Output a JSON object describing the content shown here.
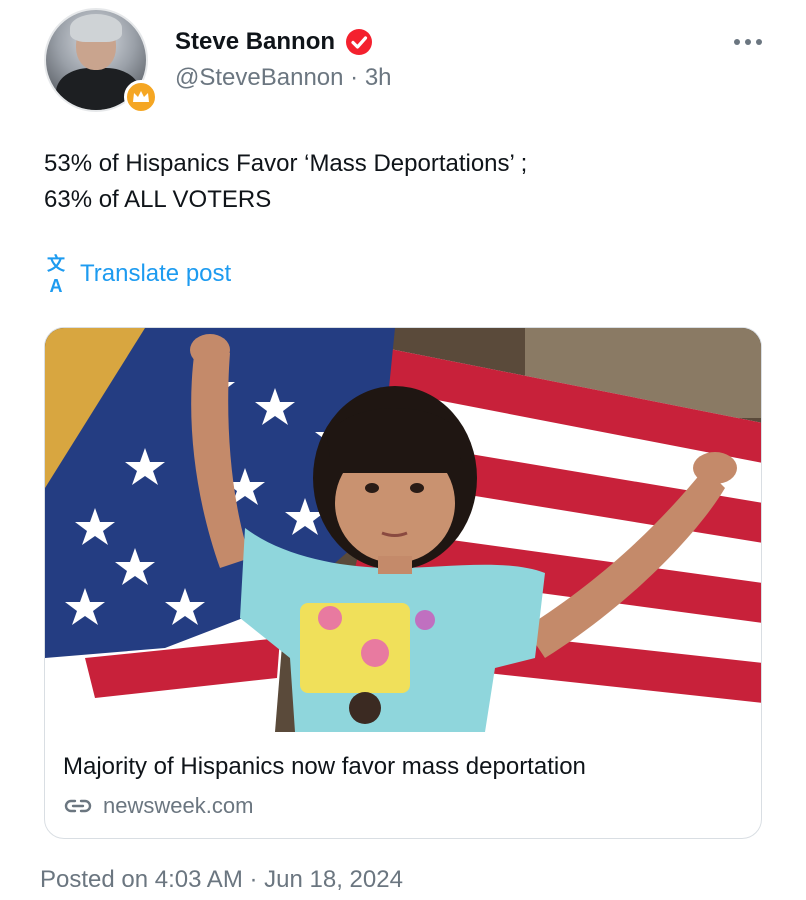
{
  "author": {
    "display_name": "Steve Bannon",
    "handle": "@SteveBannon",
    "separator": "·",
    "age": "3h",
    "verified_color": "#f4212e",
    "badge_color": "#f5a623",
    "avatar_icon": "profile-photo",
    "badge_icon": "crown-badge-icon",
    "verified_icon": "verified-check-icon"
  },
  "menu": {
    "icon": "more-horizontal-icon"
  },
  "post": {
    "lines": [
      "53% of Hispanics Favor ‘Mass Deportations’ ;",
      "63% of ALL VOTERS"
    ]
  },
  "translate": {
    "icon_glyph": "文A",
    "label": "Translate post",
    "color": "#1d9bf0"
  },
  "link_card": {
    "image_icon": "child-with-american-flag-photo",
    "title": "Majority of Hispanics now favor mass deportation",
    "source": "newsweek.com",
    "source_icon": "link-icon"
  },
  "footer": {
    "posted": "Posted on 4:03 AM · Jun 18, 2024"
  }
}
